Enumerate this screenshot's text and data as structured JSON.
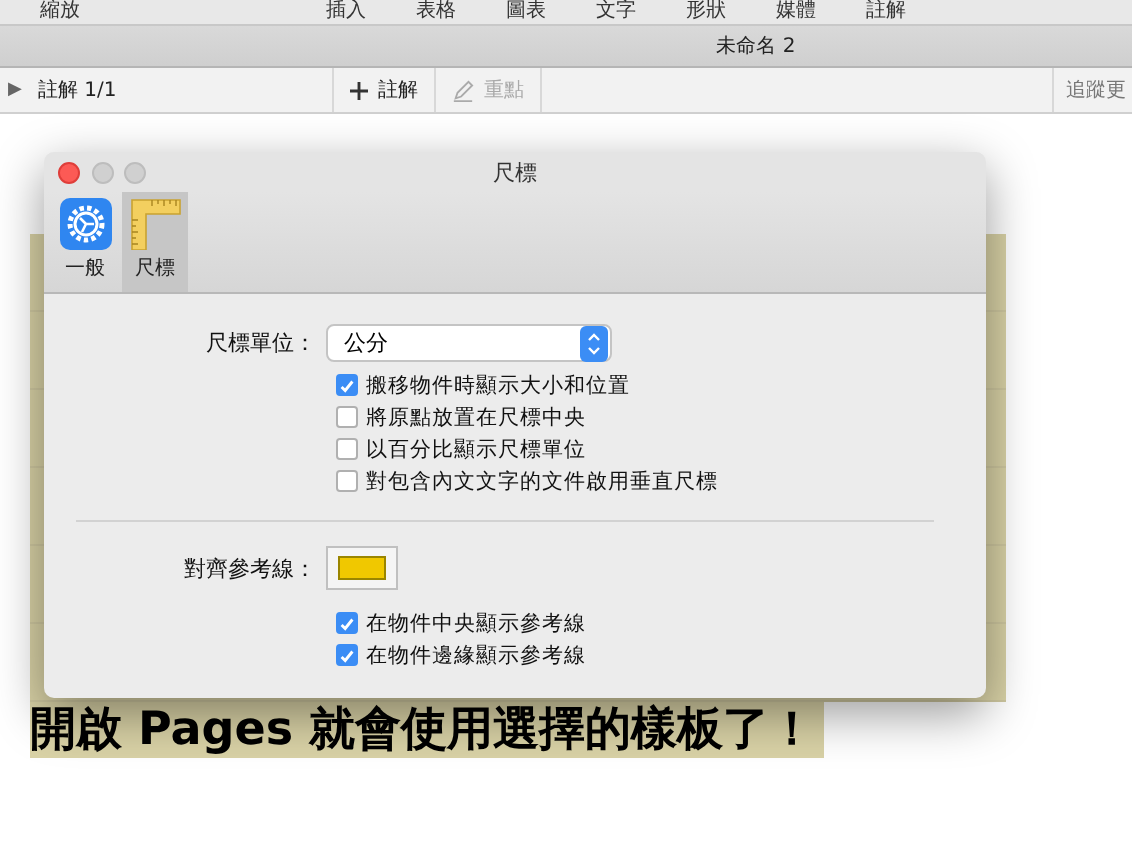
{
  "menu_bar": [
    "縮放",
    "插入",
    "表格",
    "圖表",
    "文字",
    "形狀",
    "媒體",
    "註解"
  ],
  "window": {
    "title": "未命名 2"
  },
  "comment_bar": {
    "expand_icon": "▶",
    "count": "註解 1/1",
    "add_comment": "註解",
    "highlight": "重點",
    "track_changes": "追蹤更"
  },
  "document": {
    "last_line": "開啟 Pages 就會使用選擇的樣板了！"
  },
  "dialog": {
    "title": "尺標",
    "tabs": [
      {
        "label": "一般",
        "kind": "gear",
        "selected": false
      },
      {
        "label": "尺標",
        "kind": "ruler",
        "selected": true
      }
    ],
    "ruler_units": {
      "label": "尺標單位：",
      "value": "公分"
    },
    "ruler_options": [
      {
        "label": "搬移物件時顯示大小和位置",
        "checked": true
      },
      {
        "label": "將原點放置在尺標中央",
        "checked": false
      },
      {
        "label": "以百分比顯示尺標單位",
        "checked": false
      },
      {
        "label": "對包含內文文字的文件啟用垂直尺標",
        "checked": false
      }
    ],
    "guides": {
      "label": "對齊參考線：",
      "color": "#f0c800"
    },
    "guide_options": [
      {
        "label": "在物件中央顯示參考線",
        "checked": true
      },
      {
        "label": "在物件邊緣顯示參考線",
        "checked": true
      }
    ]
  }
}
